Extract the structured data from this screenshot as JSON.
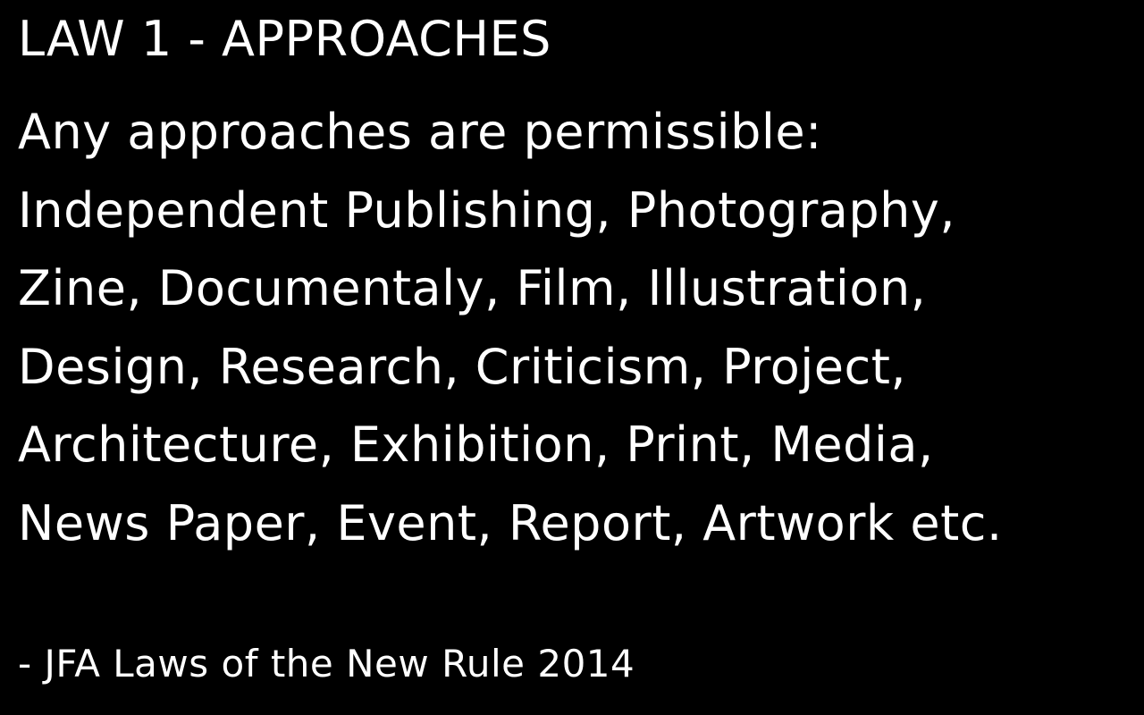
{
  "heading": "LAW 1 - APPROACHES",
  "lines": [
    "Any approaches are permissible:",
    "Independent Publishing, Photography,",
    "Zine, Documentaly, Film, Illustration,",
    "Design, Research, Criticism, Project,",
    "Architecture, Exhibition, Print, Media,",
    "News Paper, Event, Report, Artwork etc."
  ],
  "attribution": "- JFA Laws of the New Rule 2014",
  "colors": {
    "background": "#000000",
    "text": "#ffffff"
  }
}
